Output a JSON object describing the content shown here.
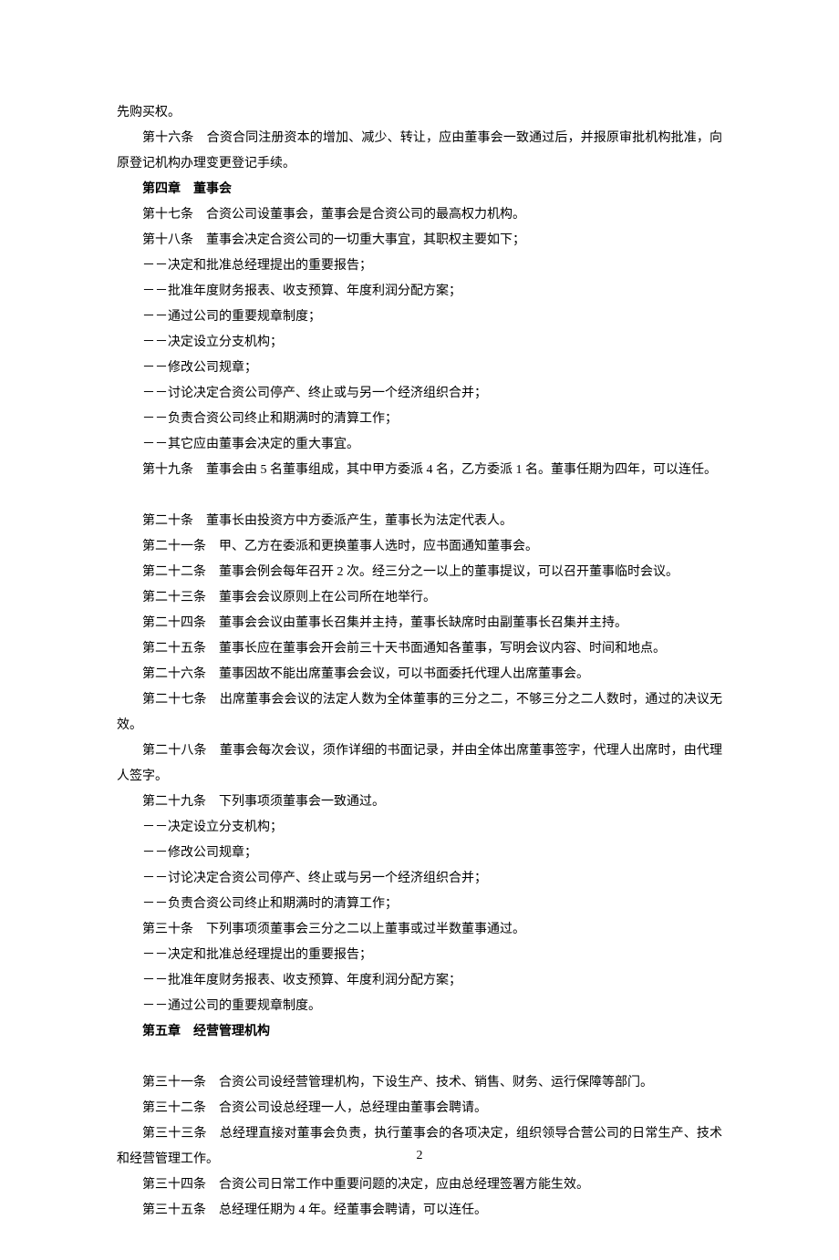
{
  "paragraphs": [
    {
      "text": "先购买权。",
      "indent": false,
      "bold": false
    },
    {
      "text": "第十六条　合资合同注册资本的增加、减少、转让，应由董事会一致通过后，并报原审批机构批准，向原登记机构办理变更登记手续。",
      "indent": true,
      "bold": false
    },
    {
      "text": "第四章　董事会",
      "indent": true,
      "bold": true
    },
    {
      "text": "第十七条　合资公司设董事会，董事会是合资公司的最高权力机构。",
      "indent": true,
      "bold": false
    },
    {
      "text": "第十八条　董事会决定合资公司的一切重大事宜，其职权主要如下；",
      "indent": true,
      "bold": false
    },
    {
      "text": "－－决定和批准总经理提出的重要报告；",
      "indent": true,
      "bold": false
    },
    {
      "text": "－－批准年度财务报表、收支预算、年度利润分配方案；",
      "indent": true,
      "bold": false
    },
    {
      "text": "－－通过公司的重要规章制度；",
      "indent": true,
      "bold": false
    },
    {
      "text": "－－决定设立分支机构；",
      "indent": true,
      "bold": false
    },
    {
      "text": "－－修改公司规章；",
      "indent": true,
      "bold": false
    },
    {
      "text": "－－讨论决定合资公司停产、终止或与另一个经济组织合并；",
      "indent": true,
      "bold": false
    },
    {
      "text": "－－负责合资公司终止和期满时的清算工作；",
      "indent": true,
      "bold": false
    },
    {
      "text": "－－其它应由董事会决定的重大事宜。",
      "indent": true,
      "bold": false
    },
    {
      "text": "第十九条　董事会由 5 名董事组成，其中甲方委派 4 名，乙方委派 1 名。董事任期为四年，可以连任。",
      "indent": true,
      "bold": false
    },
    {
      "text": "",
      "blank": true
    },
    {
      "text": "第二十条　董事长由投资方中方委派产生，董事长为法定代表人。",
      "indent": true,
      "bold": false
    },
    {
      "text": "第二十一条　甲、乙方在委派和更换董事人选时，应书面通知董事会。",
      "indent": true,
      "bold": false
    },
    {
      "text": "第二十二条　董事会例会每年召开 2 次。经三分之一以上的董事提议，可以召开董事临时会议。",
      "indent": true,
      "bold": false
    },
    {
      "text": "第二十三条　董事会会议原则上在公司所在地举行。",
      "indent": true,
      "bold": false
    },
    {
      "text": "第二十四条　董事会会议由董事长召集并主持，董事长缺席时由副董事长召集并主持。",
      "indent": true,
      "bold": false
    },
    {
      "text": "第二十五条　董事长应在董事会开会前三十天书面通知各董事，写明会议内容、时间和地点。",
      "indent": true,
      "bold": false
    },
    {
      "text": "第二十六条　董事因故不能出席董事会会议，可以书面委托代理人出席董事会。",
      "indent": true,
      "bold": false
    },
    {
      "text": "第二十七条　出席董事会会议的法定人数为全体董事的三分之二，不够三分之二人数时，通过的决议无效。",
      "indent": true,
      "bold": false
    },
    {
      "text": "第二十八条　董事会每次会议，须作详细的书面记录，并由全体出席董事签字，代理人出席时，由代理人签字。",
      "indent": true,
      "bold": false
    },
    {
      "text": "第二十九条　下列事项须董事会一致通过。",
      "indent": true,
      "bold": false
    },
    {
      "text": "－－决定设立分支机构；",
      "indent": true,
      "bold": false
    },
    {
      "text": "－－修改公司规章；",
      "indent": true,
      "bold": false
    },
    {
      "text": "－－讨论决定合资公司停产、终止或与另一个经济组织合并；",
      "indent": true,
      "bold": false
    },
    {
      "text": "－－负责合资公司终止和期满时的清算工作；",
      "indent": true,
      "bold": false
    },
    {
      "text": "第三十条　下列事项须董事会三分之二以上董事或过半数董事通过。",
      "indent": true,
      "bold": false
    },
    {
      "text": "－－决定和批准总经理提出的重要报告；",
      "indent": true,
      "bold": false
    },
    {
      "text": "－－批准年度财务报表、收支预算、年度利润分配方案；",
      "indent": true,
      "bold": false
    },
    {
      "text": "－－通过公司的重要规章制度。",
      "indent": true,
      "bold": false
    },
    {
      "text": "第五章　经营管理机构",
      "indent": true,
      "bold": true
    },
    {
      "text": "",
      "blank": true
    },
    {
      "text": "第三十一条　合资公司设经营管理机构，下设生产、技术、销售、财务、运行保障等部门。",
      "indent": true,
      "bold": false
    },
    {
      "text": "第三十二条　合资公司设总经理一人，总经理由董事会聘请。",
      "indent": true,
      "bold": false
    },
    {
      "text": "第三十三条　总经理直接对董事会负责，执行董事会的各项决定，组织领导合营公司的日常生产、技术和经营管理工作。",
      "indent": true,
      "bold": false
    },
    {
      "text": "第三十四条　合资公司日常工作中重要问题的决定，应由总经理签署方能生效。",
      "indent": true,
      "bold": false
    },
    {
      "text": "第三十五条　总经理任期为 4 年。经董事会聘请，可以连任。",
      "indent": true,
      "bold": false
    }
  ],
  "pageNumber": "2"
}
